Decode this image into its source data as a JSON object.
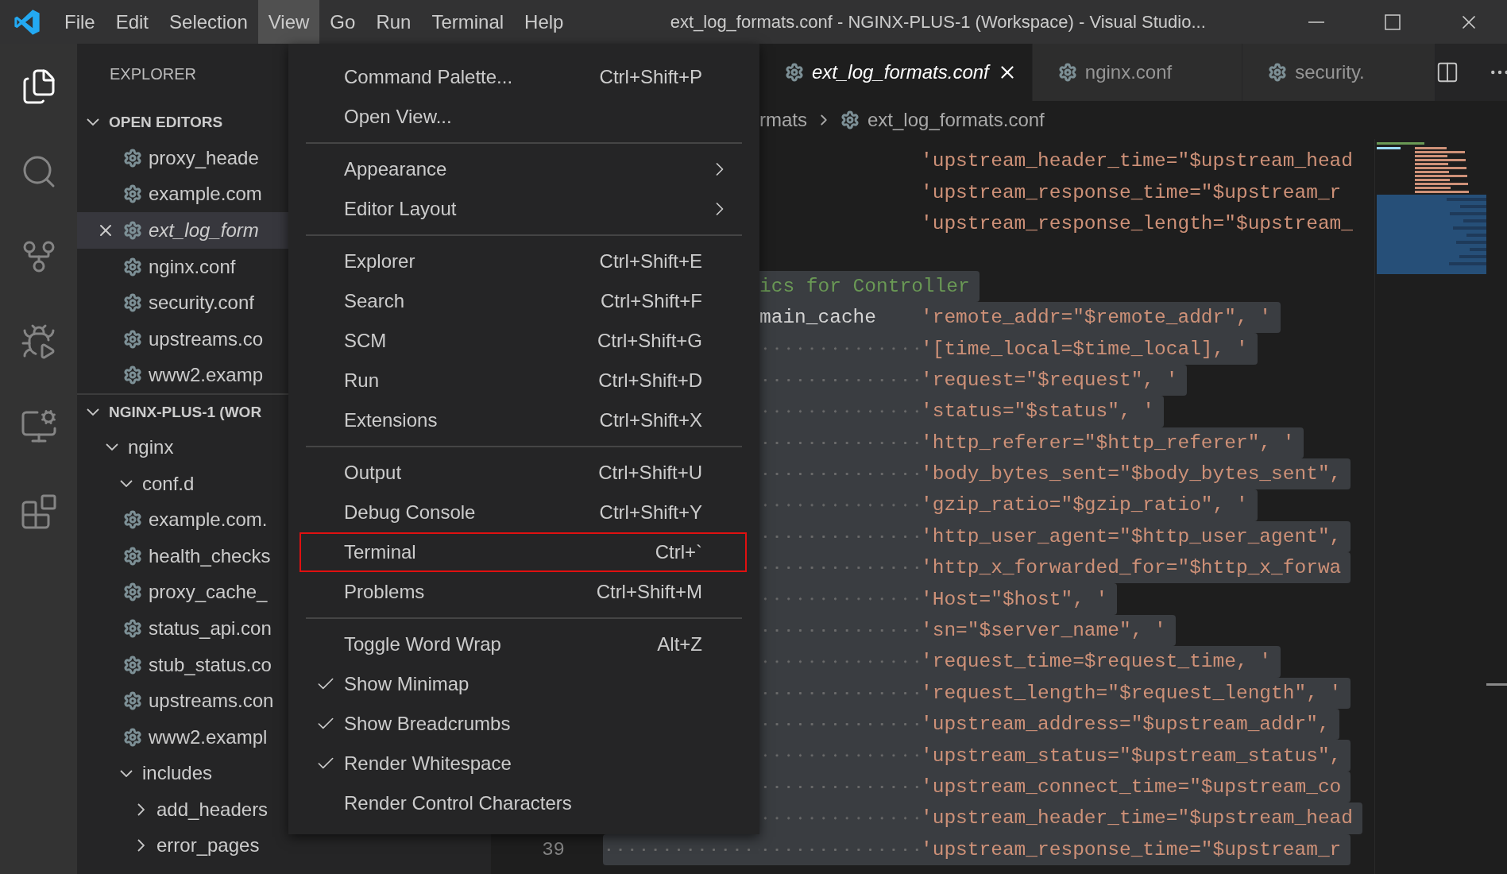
{
  "title_bar": {
    "menus": [
      {
        "label": "File",
        "selected": false
      },
      {
        "label": "Edit",
        "selected": false
      },
      {
        "label": "Selection",
        "selected": false
      },
      {
        "label": "View",
        "selected": true
      },
      {
        "label": "Go",
        "selected": false
      },
      {
        "label": "Run",
        "selected": false
      },
      {
        "label": "Terminal",
        "selected": false
      },
      {
        "label": "Help",
        "selected": false
      }
    ],
    "title": "ext_log_formats.conf - NGINX-PLUS-1 (Workspace) - Visual Studio..."
  },
  "activity_bar": [
    {
      "kind": "explorer",
      "selected": true
    },
    {
      "kind": "search",
      "selected": false
    },
    {
      "kind": "source-control",
      "selected": false
    },
    {
      "kind": "run-debug",
      "selected": false
    },
    {
      "kind": "remote",
      "selected": false
    },
    {
      "kind": "extensions",
      "selected": false
    }
  ],
  "sidebar": {
    "title": "EXPLORER",
    "open_editors": {
      "title": "OPEN EDITORS",
      "expanded": true,
      "items": [
        {
          "label": "proxy_heade",
          "selected": false,
          "preview": false
        },
        {
          "label": "example.com",
          "selected": false,
          "preview": false
        },
        {
          "label": "ext_log_form",
          "selected": true,
          "preview": true
        },
        {
          "label": "nginx.conf",
          "selected": false,
          "preview": false
        },
        {
          "label": "security.conf",
          "selected": false,
          "preview": false
        },
        {
          "label": "upstreams.co",
          "selected": false,
          "preview": false
        },
        {
          "label": "www2.examp",
          "selected": false,
          "preview": false
        }
      ]
    },
    "workspace": {
      "title": "NGINX-PLUS-1 (WOR",
      "expanded": true,
      "tree": [
        {
          "label": "nginx",
          "kind": "folder",
          "expanded": true,
          "children": [
            {
              "label": "conf.d",
              "kind": "folder",
              "expanded": true,
              "children": [
                {
                  "label": "example.com.",
                  "kind": "file"
                },
                {
                  "label": "health_checks",
                  "kind": "file"
                },
                {
                  "label": "proxy_cache_",
                  "kind": "file"
                },
                {
                  "label": "status_api.con",
                  "kind": "file"
                },
                {
                  "label": "stub_status.co",
                  "kind": "file"
                },
                {
                  "label": "upstreams.con",
                  "kind": "file"
                },
                {
                  "label": "www2.exampl",
                  "kind": "file"
                }
              ]
            },
            {
              "label": "includes",
              "kind": "folder",
              "expanded": true,
              "children": [
                {
                  "label": "add_headers",
                  "kind": "folder",
                  "expanded": false
                },
                {
                  "label": "error_pages",
                  "kind": "folder",
                  "expanded": false
                }
              ]
            }
          ]
        }
      ]
    }
  },
  "tabs": [
    {
      "label": "ext_log_formats.conf",
      "selected": true,
      "preview": true
    },
    {
      "label": "nginx.conf",
      "selected": false,
      "preview": false
    },
    {
      "label": "security.",
      "selected": false,
      "preview": false
    }
  ],
  "breadcrumbs": [
    {
      "label": "rmats",
      "kind": "folder"
    },
    {
      "label": "ext_log_formats.conf",
      "kind": "file"
    }
  ],
  "editor": {
    "lines": [
      {
        "selected": false,
        "tokens": [
          {
            "kind": "string",
            "text": "'upstream_header_time=\"$upstream_head"
          }
        ]
      },
      {
        "selected": false,
        "tokens": [
          {
            "kind": "string",
            "text": "'upstream_response_time=\"$upstream_r"
          }
        ]
      },
      {
        "selected": false,
        "tokens": [
          {
            "kind": "string",
            "text": "'upstream_response_length=\"$upstream_"
          }
        ]
      },
      {
        "selected": false
      },
      {
        "selected": true,
        "tokens": [
          {
            "kind": "comment",
            "text": "ics for Controller"
          }
        ]
      },
      {
        "selected": true,
        "tokens": [
          {
            "kind": "identifier",
            "text": "main_cache"
          },
          {
            "kind": "string",
            "text": "'remote_addr=\"$remote_addr\", '"
          }
        ]
      },
      {
        "selected": true,
        "tokens": [
          {
            "kind": "string",
            "text": "'[time_local=$time_local], '"
          }
        ]
      },
      {
        "selected": true,
        "tokens": [
          {
            "kind": "string",
            "text": "'request=\"$request\", '"
          }
        ]
      },
      {
        "selected": true,
        "tokens": [
          {
            "kind": "string",
            "text": "'status=\"$status\", '"
          }
        ]
      },
      {
        "selected": true,
        "tokens": [
          {
            "kind": "string",
            "text": "'http_referer=\"$http_referer\", '"
          }
        ]
      },
      {
        "selected": true,
        "tokens": [
          {
            "kind": "string",
            "text": "'body_bytes_sent=\"$body_bytes_sent\","
          }
        ]
      },
      {
        "selected": true,
        "tokens": [
          {
            "kind": "string",
            "text": "'gzip_ratio=\"$gzip_ratio\", '"
          }
        ]
      },
      {
        "selected": true,
        "tokens": [
          {
            "kind": "string",
            "text": "'http_user_agent=\"$http_user_agent\","
          }
        ]
      },
      {
        "selected": true,
        "tokens": [
          {
            "kind": "string",
            "text": "'http_x_forwarded_for=\"$http_x_forwa"
          }
        ]
      },
      {
        "selected": true,
        "tokens": [
          {
            "kind": "string",
            "text": "'Host=\"$host\", '"
          }
        ]
      },
      {
        "selected": true,
        "tokens": [
          {
            "kind": "string",
            "text": "'sn=\"$server_name\", '"
          }
        ]
      },
      {
        "selected": true,
        "tokens": [
          {
            "kind": "string",
            "text": "'request_time=$request_time, '"
          }
        ]
      },
      {
        "selected": true,
        "tokens": [
          {
            "kind": "string",
            "text": "'request_length=\"$request_length\", '"
          }
        ]
      },
      {
        "selected": true,
        "tokens": [
          {
            "kind": "string",
            "text": "'upstream_address=\"$upstream_addr\","
          }
        ]
      },
      {
        "selected": true,
        "tokens": [
          {
            "kind": "string",
            "text": "'upstream_status=\"$upstream_status\","
          }
        ]
      },
      {
        "selected": true,
        "tokens": [
          {
            "kind": "string",
            "text": "'upstream_connect_time=\"$upstream_co"
          }
        ]
      },
      {
        "selected": true,
        "tokens": [
          {
            "kind": "string",
            "text": "'upstream_header_time=\"$upstream_head"
          }
        ]
      },
      {
        "selected": true,
        "line_number": "39",
        "tokens": [
          {
            "kind": "string",
            "text": "'upstream_response_time=\"$upstream_r"
          }
        ]
      }
    ]
  },
  "view_menu": {
    "groups": [
      [
        {
          "label": "Command Palette...",
          "shortcut": "Ctrl+Shift+P",
          "kind": "item",
          "checked": false,
          "highlighted": false
        },
        {
          "label": "Open View...",
          "kind": "item",
          "checked": false,
          "highlighted": false
        }
      ],
      [
        {
          "label": "Appearance",
          "kind": "submenu",
          "checked": false,
          "highlighted": false
        },
        {
          "label": "Editor Layout",
          "kind": "submenu",
          "checked": false,
          "highlighted": false
        }
      ],
      [
        {
          "label": "Explorer",
          "shortcut": "Ctrl+Shift+E",
          "kind": "item",
          "checked": false,
          "highlighted": false
        },
        {
          "label": "Search",
          "shortcut": "Ctrl+Shift+F",
          "kind": "item",
          "checked": false,
          "highlighted": false
        },
        {
          "label": "SCM",
          "shortcut": "Ctrl+Shift+G",
          "kind": "item",
          "checked": false,
          "highlighted": false
        },
        {
          "label": "Run",
          "shortcut": "Ctrl+Shift+D",
          "kind": "item",
          "checked": false,
          "highlighted": false
        },
        {
          "label": "Extensions",
          "shortcut": "Ctrl+Shift+X",
          "kind": "item",
          "checked": false,
          "highlighted": false
        }
      ],
      [
        {
          "label": "Output",
          "shortcut": "Ctrl+Shift+U",
          "kind": "item",
          "checked": false,
          "highlighted": false
        },
        {
          "label": "Debug Console",
          "shortcut": "Ctrl+Shift+Y",
          "kind": "item",
          "checked": false,
          "highlighted": false
        },
        {
          "label": "Terminal",
          "shortcut": "Ctrl+`",
          "kind": "item",
          "checked": false,
          "highlighted": true
        },
        {
          "label": "Problems",
          "shortcut": "Ctrl+Shift+M",
          "kind": "item",
          "checked": false,
          "highlighted": false
        }
      ],
      [
        {
          "label": "Toggle Word Wrap",
          "shortcut": "Alt+Z",
          "kind": "item",
          "checked": false,
          "highlighted": false
        },
        {
          "label": "Show Minimap",
          "kind": "item",
          "checked": true,
          "highlighted": false
        },
        {
          "label": "Show Breadcrumbs",
          "kind": "item",
          "checked": true,
          "highlighted": false
        },
        {
          "label": "Render Whitespace",
          "kind": "item",
          "checked": true,
          "highlighted": false
        },
        {
          "label": "Render Control Characters",
          "kind": "item",
          "checked": false,
          "highlighted": false
        }
      ]
    ]
  }
}
